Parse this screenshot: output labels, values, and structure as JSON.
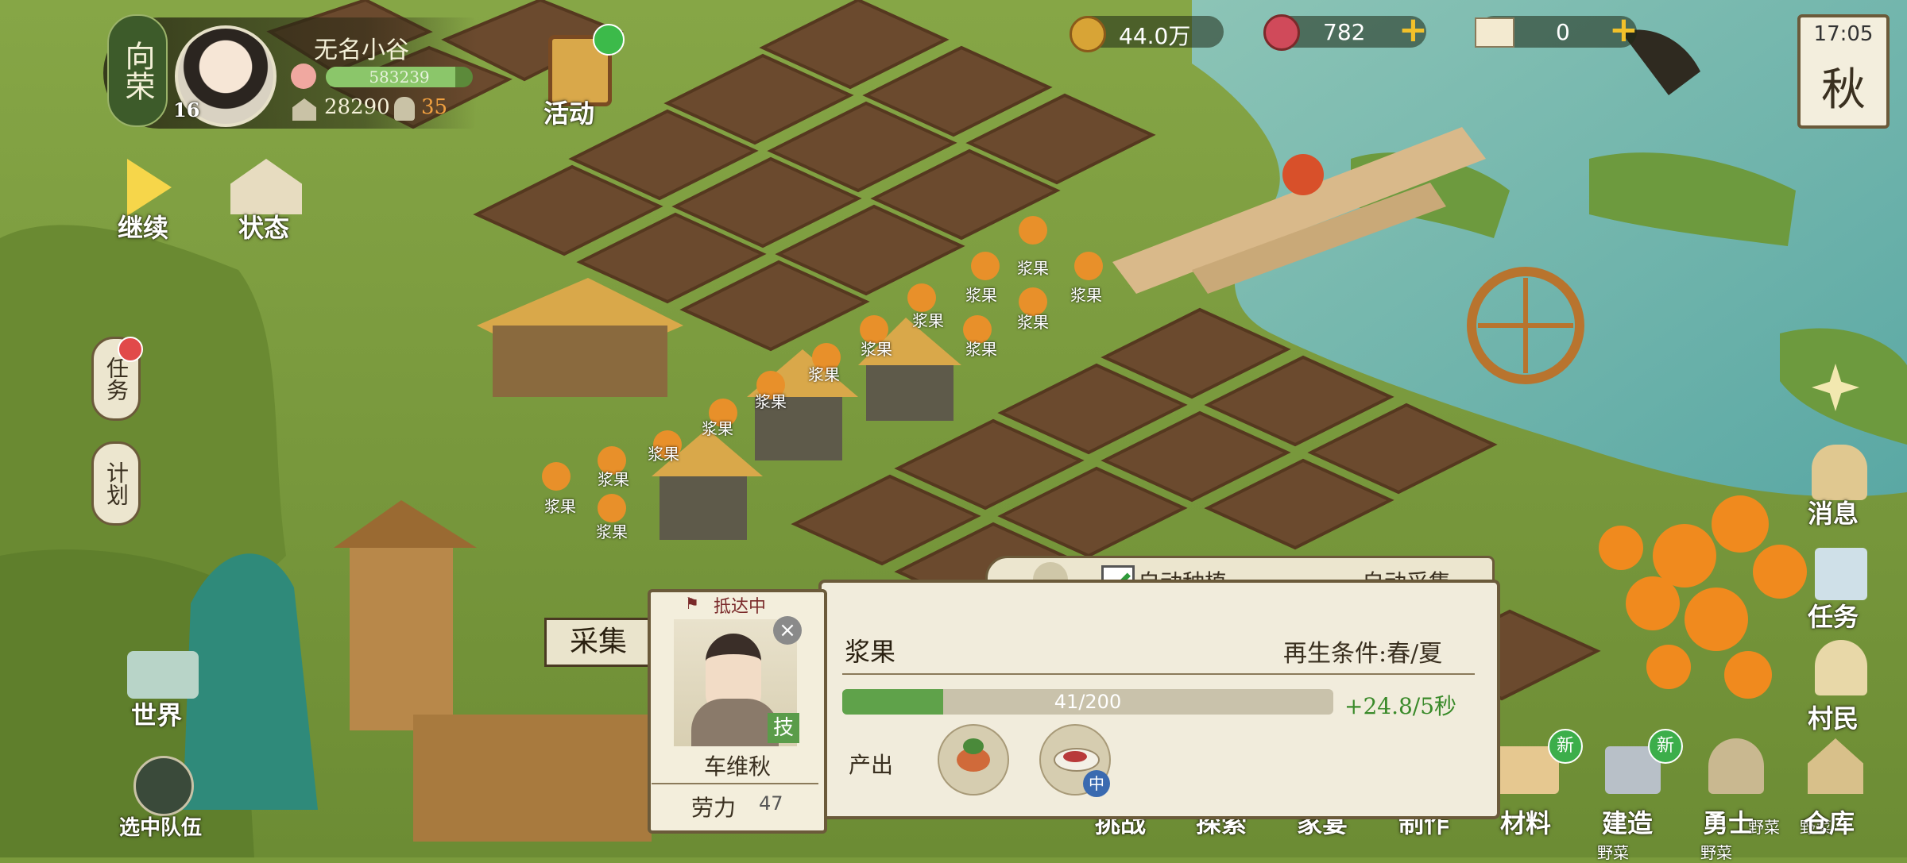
{
  "profile": {
    "clan_name": "向荣",
    "level": "16",
    "village_name": "无名小谷",
    "exp": "583239",
    "houses": "28290",
    "population": "35"
  },
  "event": {
    "label": "活动"
  },
  "currencies": {
    "coins": "44.0万",
    "gems": "782",
    "tickets": "0"
  },
  "clock": {
    "time": "17:05",
    "season": "秋"
  },
  "left_menu": {
    "continue": "继续",
    "status": "状态",
    "tasks": "任务",
    "plan": "计划",
    "world": "世界",
    "selected_team": "选中队伍"
  },
  "right_menu": {
    "messages": "消息",
    "tasks": "任务",
    "villagers": "村民"
  },
  "bottom_nav": {
    "challenge": "挑战",
    "explore": "探索",
    "family": "家宴",
    "craft": "制作",
    "materials": "材料",
    "build": "建造",
    "warrior": "勇士",
    "warehouse": "仓库",
    "new_badge": "新"
  },
  "crop_labels": {
    "berry": "浆果",
    "wild_veg": "野菜"
  },
  "panel": {
    "auto_plant": "自动种植",
    "auto_gather": "自动采集",
    "gather_tag": "采集",
    "worker_status": "抵达中",
    "worker_name": "车维秋",
    "skill_badge": "技",
    "labor_label": "劳力",
    "labor_value": "47",
    "resource_name": "浆果",
    "regen": "再生条件:春/夏",
    "progress_text": "41/200",
    "progress": 0.205,
    "rate": "+24.8/5秒",
    "output_label": "产出",
    "quality_badge": "中"
  },
  "colors": {
    "grass": "#7a9a3c",
    "water": "#6fb8b0",
    "soil": "#6b4a2e",
    "accent_green": "#5fa24a",
    "currency_plus": "#f2c12a"
  }
}
